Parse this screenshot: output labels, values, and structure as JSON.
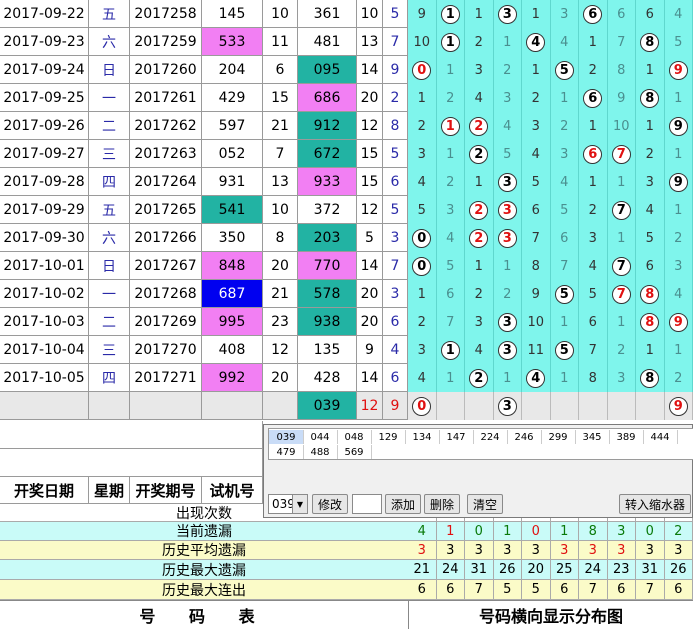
{
  "rows": [
    {
      "date": "2017-09-22",
      "wk": "五",
      "issue": "2017258",
      "trial": "145",
      "span": "10",
      "kj": "361",
      "sum": "10",
      "k": "5",
      "hl": "none",
      "kjhl": "none",
      "dist": [
        "9",
        "c:1",
        "1",
        "c:3",
        "1",
        "3",
        "c:6",
        "6",
        "6",
        "4"
      ]
    },
    {
      "date": "2017-09-23",
      "wk": "六",
      "issue": "2017259",
      "trial": "533",
      "span": "11",
      "kj": "481",
      "sum": "13",
      "k": "7",
      "hl": "pink",
      "kjhl": "none",
      "dist": [
        "10",
        "c:1",
        "2",
        "1",
        "c:4",
        "4",
        "1",
        "7",
        "c:8",
        "5"
      ]
    },
    {
      "date": "2017-09-24",
      "wk": "日",
      "issue": "2017260",
      "trial": "204",
      "span": "6",
      "kj": "095",
      "sum": "14",
      "k": "9",
      "hl": "none",
      "kjhl": "teal",
      "dist": [
        "r:0",
        "1",
        "3",
        "2",
        "1",
        "c:5",
        "2",
        "8",
        "1",
        "r:9"
      ]
    },
    {
      "date": "2017-09-25",
      "wk": "一",
      "issue": "2017261",
      "trial": "429",
      "span": "15",
      "kj": "686",
      "sum": "20",
      "k": "2",
      "hl": "none",
      "kjhl": "pink",
      "dist": [
        "1",
        "2",
        "4",
        "3",
        "2",
        "1",
        "c:6",
        "9",
        "c:8",
        "1"
      ]
    },
    {
      "date": "2017-09-26",
      "wk": "二",
      "issue": "2017262",
      "trial": "597",
      "span": "21",
      "kj": "912",
      "sum": "12",
      "k": "8",
      "hl": "none",
      "kjhl": "teal",
      "dist": [
        "2",
        "r:1",
        "r:2",
        "4",
        "3",
        "2",
        "1",
        "10",
        "1",
        "c:9"
      ]
    },
    {
      "date": "2017-09-27",
      "wk": "三",
      "issue": "2017263",
      "trial": "052",
      "span": "7",
      "kj": "672",
      "sum": "15",
      "k": "5",
      "hl": "none",
      "kjhl": "teal",
      "dist": [
        "3",
        "1",
        "c:2",
        "5",
        "4",
        "3",
        "r:6",
        "r:7",
        "2",
        "1"
      ]
    },
    {
      "date": "2017-09-28",
      "wk": "四",
      "issue": "2017264",
      "trial": "931",
      "span": "13",
      "kj": "933",
      "sum": "15",
      "k": "6",
      "hl": "none",
      "kjhl": "pink",
      "dist": [
        "4",
        "2",
        "1",
        "c:3",
        "5",
        "4",
        "1",
        "1",
        "3",
        "c:9"
      ]
    },
    {
      "date": "2017-09-29",
      "wk": "五",
      "issue": "2017265",
      "trial": "541",
      "span": "10",
      "kj": "372",
      "sum": "12",
      "k": "5",
      "hl": "teal",
      "kjhl": "none",
      "dist": [
        "5",
        "3",
        "r:2",
        "r:3",
        "6",
        "5",
        "2",
        "c:7",
        "4",
        "1"
      ]
    },
    {
      "date": "2017-09-30",
      "wk": "六",
      "issue": "2017266",
      "trial": "350",
      "span": "8",
      "kj": "203",
      "sum": "5",
      "k": "3",
      "hl": "none",
      "kjhl": "teal",
      "dist": [
        "c:0",
        "4",
        "r:2",
        "r:3",
        "7",
        "6",
        "3",
        "1",
        "5",
        "2"
      ]
    },
    {
      "date": "2017-10-01",
      "wk": "日",
      "issue": "2017267",
      "trial": "848",
      "span": "20",
      "kj": "770",
      "sum": "14",
      "k": "7",
      "hl": "pink",
      "kjhl": "pink",
      "dist": [
        "c:0",
        "5",
        "1",
        "1",
        "8",
        "7",
        "4",
        "c:7",
        "6",
        "3"
      ]
    },
    {
      "date": "2017-10-02",
      "wk": "一",
      "issue": "2017268",
      "trial": "687",
      "span": "21",
      "kj": "578",
      "sum": "20",
      "k": "3",
      "hl": "blue",
      "kjhl": "teal",
      "dist": [
        "1",
        "6",
        "2",
        "2",
        "9",
        "c:5",
        "5",
        "r:7",
        "r:8",
        "4"
      ]
    },
    {
      "date": "2017-10-03",
      "wk": "二",
      "issue": "2017269",
      "trial": "995",
      "span": "23",
      "kj": "938",
      "sum": "20",
      "k": "6",
      "hl": "pink",
      "kjhl": "teal",
      "dist": [
        "2",
        "7",
        "3",
        "c:3",
        "10",
        "1",
        "6",
        "1",
        "r:8",
        "r:9"
      ]
    },
    {
      "date": "2017-10-04",
      "wk": "三",
      "issue": "2017270",
      "trial": "408",
      "span": "12",
      "kj": "135",
      "sum": "9",
      "k": "4",
      "hl": "none",
      "kjhl": "none",
      "dist": [
        "3",
        "c:1",
        "4",
        "c:3",
        "11",
        "c:5",
        "7",
        "2",
        "1",
        "1"
      ]
    },
    {
      "date": "2017-10-05",
      "wk": "四",
      "issue": "2017271",
      "trial": "992",
      "span": "20",
      "kj": "428",
      "sum": "14",
      "k": "6",
      "hl": "pink",
      "kjhl": "none",
      "dist": [
        "4",
        "1",
        "c:2",
        "1",
        "c:4",
        "1",
        "8",
        "3",
        "c:8",
        "2"
      ]
    }
  ],
  "pending": {
    "kj": "039",
    "sum": "12",
    "k": "9",
    "dist": [
      "r:0",
      "",
      "",
      "c:3",
      "",
      "",
      "",
      "",
      "",
      "r:9"
    ]
  },
  "headers": {
    "date": "开奖日期",
    "week": "星期",
    "issue": "开奖期号",
    "trial": "试机号"
  },
  "stats": {
    "labels": [
      "出现次数",
      "当前遗漏",
      "历史平均遗漏",
      "历史最大遗漏",
      "历史最大连出"
    ],
    "current": [
      "4",
      "1",
      "0",
      "1",
      "0",
      "1",
      "8",
      "3",
      "0",
      "2"
    ],
    "average": [
      "3",
      "3",
      "3",
      "3",
      "3",
      "3",
      "3",
      "3",
      "3",
      "3"
    ],
    "maxmiss": [
      "21",
      "24",
      "31",
      "26",
      "20",
      "25",
      "24",
      "23",
      "31",
      "26"
    ],
    "maxrun": [
      "6",
      "6",
      "7",
      "5",
      "5",
      "6",
      "7",
      "6",
      "7",
      "6"
    ]
  },
  "footer": {
    "left": "号 码 表",
    "right": "号码横向显示分布图"
  },
  "panel": {
    "list_row1": [
      "039",
      "044",
      "048",
      "129",
      "134",
      "147",
      "224",
      "246",
      "299",
      "345",
      "389",
      "444"
    ],
    "list_row2": [
      "479",
      "488",
      "569"
    ],
    "combo_value": "039",
    "modify": "修改",
    "add": "添加",
    "delete": "删除",
    "clear": "清空",
    "transfer": "转入缩水器"
  },
  "colors": {
    "teal": "#22b3a3",
    "pink": "#f27ff3",
    "blue": "#0000f0",
    "cyan": "#7ff5ec",
    "yellow": "#fbfbc8",
    "lightcyan": "#c9fbf8"
  }
}
